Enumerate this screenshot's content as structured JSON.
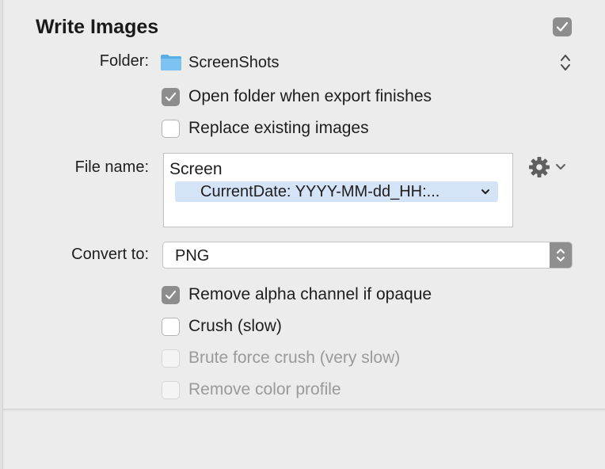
{
  "section": {
    "title": "Write Images",
    "enabled": true
  },
  "folder": {
    "label": "Folder:",
    "value": "ScreenShots",
    "icon": "folder-icon"
  },
  "options_top": [
    {
      "label": "Open folder when export finishes",
      "checked": true,
      "disabled": false
    },
    {
      "label": "Replace existing images",
      "checked": false,
      "disabled": false
    }
  ],
  "filename": {
    "label": "File name:",
    "prefix": "Screen",
    "token": "CurrentDate: YYYY-MM-dd_HH:..."
  },
  "convert": {
    "label": "Convert to:",
    "value": "PNG"
  },
  "options_bottom": [
    {
      "label": "Remove alpha channel if opaque",
      "checked": true,
      "disabled": false
    },
    {
      "label": "Crush (slow)",
      "checked": false,
      "disabled": false
    },
    {
      "label": "Brute force crush (very slow)",
      "checked": false,
      "disabled": true
    },
    {
      "label": "Remove color profile",
      "checked": false,
      "disabled": true
    }
  ],
  "colors": {
    "checkbox_on": "#8d8d8d",
    "token_bg": "#d5e3f7",
    "folder_blue": "#6ab8ee",
    "background": "#ececec"
  }
}
